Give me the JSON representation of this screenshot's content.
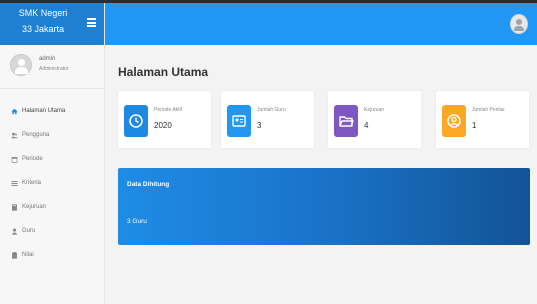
{
  "brand": {
    "line1": "SMK Negeri",
    "line2": "33 Jakarta"
  },
  "user": {
    "name": "admin",
    "role": "Administrator"
  },
  "sidebar": {
    "items": [
      {
        "label": "Halaman Utama",
        "icon": "home-icon",
        "active": true
      },
      {
        "label": "Pengguna",
        "icon": "users-icon"
      },
      {
        "label": "Periode",
        "icon": "calendar-icon"
      },
      {
        "label": "Kriteria",
        "icon": "list-icon"
      },
      {
        "label": "Kejuruan",
        "icon": "book-icon"
      },
      {
        "label": "Guru",
        "icon": "user-icon"
      },
      {
        "label": "Nilai",
        "icon": "clipboard-icon"
      }
    ]
  },
  "main": {
    "title": "Halaman Utama",
    "cards": [
      {
        "label": "Periode Aktif",
        "value": "2020",
        "color": "#1e88e5",
        "icon": "clock-icon"
      },
      {
        "label": "Jumlah Guru",
        "value": "3",
        "color": "#2196f3",
        "icon": "id-card-icon"
      },
      {
        "label": "Kejuruan",
        "value": "4",
        "color": "#7e57c2",
        "icon": "folder-icon"
      },
      {
        "label": "Jumlah Penilai",
        "value": "1",
        "color": "#ffa726",
        "icon": "person-circle-icon"
      }
    ],
    "banner": {
      "title": "Data Dihitung",
      "value": "3 Guru"
    }
  },
  "colors": {
    "topbar": "#2196f3",
    "brand": "#1f7fd0",
    "sidebar": "#f7f7f7",
    "content": "#f3f3f3"
  }
}
